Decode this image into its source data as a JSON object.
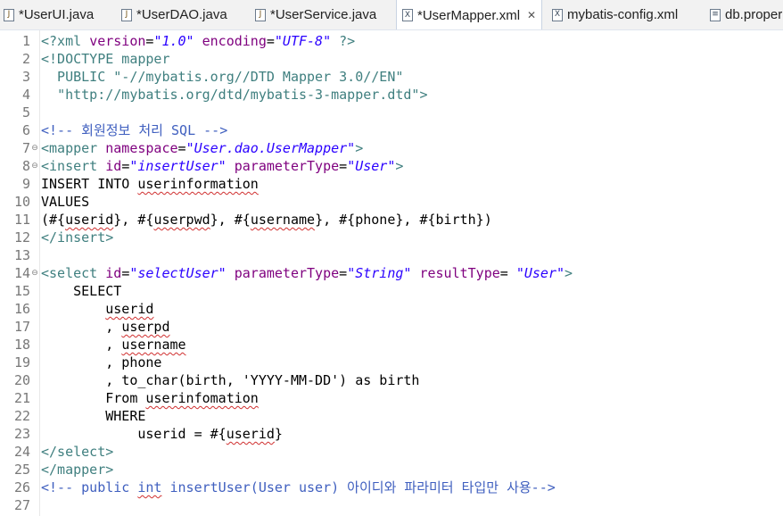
{
  "tabs": [
    {
      "label": "*UserUI.java",
      "icon": "java-file-icon",
      "active": false
    },
    {
      "label": "*UserDAO.java",
      "icon": "java-file-icon",
      "active": false
    },
    {
      "label": "*UserService.java",
      "icon": "java-file-icon",
      "active": false
    },
    {
      "label": "*UserMapper.xml",
      "icon": "xml-file-icon",
      "active": true,
      "close": "✕"
    },
    {
      "label": "mybatis-config.xml",
      "icon": "xml-file-icon",
      "active": false
    },
    {
      "label": "db.proper",
      "icon": "file-icon",
      "active": false
    }
  ],
  "line_numbers": [
    "1",
    "2",
    "3",
    "4",
    "5",
    "6",
    "7",
    "8",
    "9",
    "10",
    "11",
    "12",
    "13",
    "14",
    "15",
    "16",
    "17",
    "18",
    "19",
    "20",
    "21",
    "22",
    "23",
    "24",
    "25",
    "26",
    "27"
  ],
  "fold_markers": [
    "⊖",
    "⊖",
    "⊖"
  ],
  "code": {
    "l1": [
      "<?xml ",
      "version",
      "=",
      "\"1.0\"",
      " ",
      "encoding",
      "=",
      "\"UTF-8\"",
      " ?>"
    ],
    "l2": [
      "<!DOCTYPE mapper"
    ],
    "l3": [
      "  PUBLIC ",
      "\"-//mybatis.org//DTD Mapper 3.0//EN\""
    ],
    "l4": [
      "  ",
      "\"http://mybatis.org/dtd/mybatis-3-mapper.dtd\"",
      ">"
    ],
    "l6": [
      "<!-- 회원정보 처리 SQL -->"
    ],
    "l7": [
      "<mapper ",
      "namespace",
      "=",
      "\"User.dao.UserMapper\"",
      ">"
    ],
    "l8": [
      "<insert ",
      "id",
      "=",
      "\"insertUser\"",
      " ",
      "parameterType",
      "=",
      "\"User\"",
      ">"
    ],
    "l9": [
      "INSERT INTO ",
      "userinformation"
    ],
    "l10": [
      "VALUES"
    ],
    "l11": [
      "(#{",
      "userid",
      "}, #{",
      "userpwd",
      "}, #{",
      "username",
      "}, #{phone}, #{birth})"
    ],
    "l12": [
      "</insert>"
    ],
    "l14": [
      "<select ",
      "id",
      "=",
      "\"selectUser\"",
      " ",
      "parameterType",
      "=",
      "\"String\"",
      " ",
      "resultType",
      "= ",
      "\"User\"",
      ">"
    ],
    "l15": [
      "    SELECT"
    ],
    "l16": [
      "        ",
      "userid"
    ],
    "l17": [
      "        , ",
      "userpd"
    ],
    "l18": [
      "        , ",
      "username"
    ],
    "l19": [
      "        , phone"
    ],
    "l20": [
      "        , to_char(birth, 'YYYY-MM-DD') as birth"
    ],
    "l21": [
      "        From ",
      "userinfomation"
    ],
    "l22": [
      "        WHERE"
    ],
    "l23": [
      "            userid",
      " = #{",
      "userid",
      "}"
    ],
    "l24": [
      "</select>"
    ],
    "l25": [
      "</mapper>"
    ],
    "l26": [
      "<!-- public ",
      "int",
      " insertUser(User user) 아이디와 파라미터 타입만 사용-->"
    ]
  }
}
